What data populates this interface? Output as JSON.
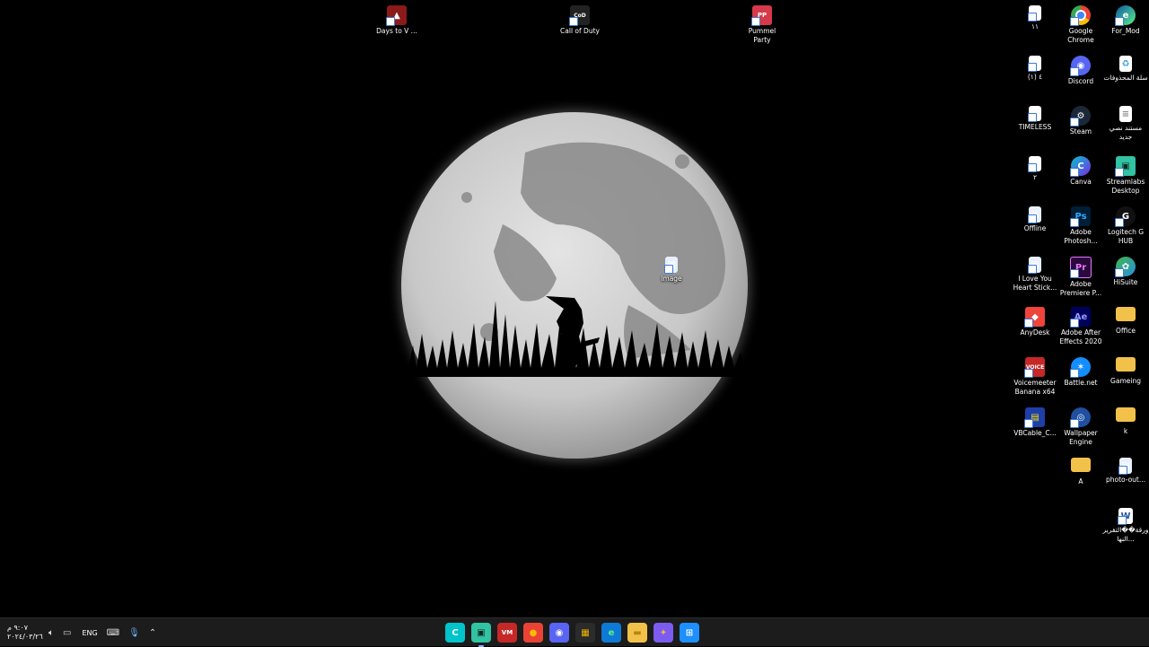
{
  "desktop": {
    "icons_top": [
      {
        "label": "Days to V ...",
        "name": "days-to-v",
        "color": "#8b1a1a"
      },
      {
        "label": "Call of Duty",
        "name": "call-of-duty",
        "color": "#222222"
      },
      {
        "label": "Pummel Party",
        "name": "pummel-party",
        "color": "#d63a4a"
      }
    ],
    "column_1": [
      {
        "label": "١١",
        "name": "video-11"
      },
      {
        "label": "(١) ٤",
        "name": "video-4"
      },
      {
        "label": "TIMELESS",
        "name": "video-timeless"
      },
      {
        "label": "٢",
        "name": "video-2"
      },
      {
        "label": "Offline",
        "name": "offline"
      },
      {
        "label": "I Love You Heart Stick...",
        "name": "i-love-you-heart-stick"
      },
      {
        "label": "AnyDesk",
        "name": "anydesk"
      },
      {
        "label": "Voicemeeter Banana x64",
        "name": "voicemeeter-banana"
      },
      {
        "label": "VBCable_C...",
        "name": "vbcable"
      }
    ],
    "column_2": [
      {
        "label": "Google Chrome",
        "name": "google-chrome"
      },
      {
        "label": "Discord",
        "name": "discord"
      },
      {
        "label": "Steam",
        "name": "steam"
      },
      {
        "label": "Canva",
        "name": "canva"
      },
      {
        "label": "Adobe Photosh...",
        "name": "adobe-photoshop"
      },
      {
        "label": "Adobe Premiere P...",
        "name": "adobe-premiere"
      },
      {
        "label": "Adobe After Effects 2020",
        "name": "adobe-after-effects"
      },
      {
        "label": "Battle.net",
        "name": "battle-net"
      },
      {
        "label": "Wallpaper Engine",
        "name": "wallpaper-engine"
      },
      {
        "label": "A",
        "name": "folder-a"
      }
    ],
    "column_3": [
      {
        "label": "For_Mod",
        "name": "for-mod"
      },
      {
        "label": "سلة المحذوفات",
        "name": "recycle-bin"
      },
      {
        "label": "مستند نصي جديد",
        "name": "new-text-document"
      },
      {
        "label": "Streamlabs Desktop",
        "name": "streamlabs-desktop"
      },
      {
        "label": "Logitech G HUB",
        "name": "logitech-g-hub"
      },
      {
        "label": "HiSuite",
        "name": "hisuite"
      },
      {
        "label": "Office",
        "name": "folder-office"
      },
      {
        "label": "Gameing",
        "name": "folder-gameing"
      },
      {
        "label": "k",
        "name": "folder-k"
      },
      {
        "label": "photo-out...",
        "name": "photo-out"
      },
      {
        "label": "ورقة��التقرير النها...",
        "name": "report-docx"
      }
    ],
    "center_icon": {
      "label": "image",
      "name": "image-file"
    }
  },
  "taskbar": {
    "clock_time": "٩:٠٧ م",
    "clock_date": "٢٠٢٤/٠٣/٢٦",
    "language": "ENG",
    "apps": [
      {
        "name": "canva",
        "glyph": "C",
        "bg": "#00c4cc",
        "fg": "#ffffff"
      },
      {
        "name": "streamlabs",
        "glyph": "▣",
        "bg": "#31c3a2",
        "fg": "#0a2a22",
        "active": true
      },
      {
        "name": "voicemeeter",
        "glyph": "VM",
        "bg": "#c62828",
        "fg": "#ffffff"
      },
      {
        "name": "google-chrome",
        "glyph": "●",
        "bg": "#ea4335",
        "fg": "#fbbc04"
      },
      {
        "name": "discord",
        "glyph": "◉",
        "bg": "#5865f2",
        "fg": "#ffffff"
      },
      {
        "name": "microsoft-store",
        "glyph": "▦",
        "bg": "#2b2b2b",
        "fg": "#f0b400"
      },
      {
        "name": "edge",
        "glyph": "e",
        "bg": "#0f7ad6",
        "fg": "#5cf08a"
      },
      {
        "name": "file-explorer",
        "glyph": "▬",
        "bg": "#f2c14a",
        "fg": "#b8860b"
      },
      {
        "name": "copilot",
        "glyph": "✦",
        "bg": "#7b5cf0",
        "fg": "#ffb347"
      },
      {
        "name": "windows-start",
        "glyph": "⊞",
        "bg": "#1e8fff",
        "fg": "#ffffff"
      }
    ]
  },
  "colors": {
    "desktop_bg": "#000000",
    "moon": "#cfcfcf",
    "taskbar": "#1c1c1c"
  }
}
